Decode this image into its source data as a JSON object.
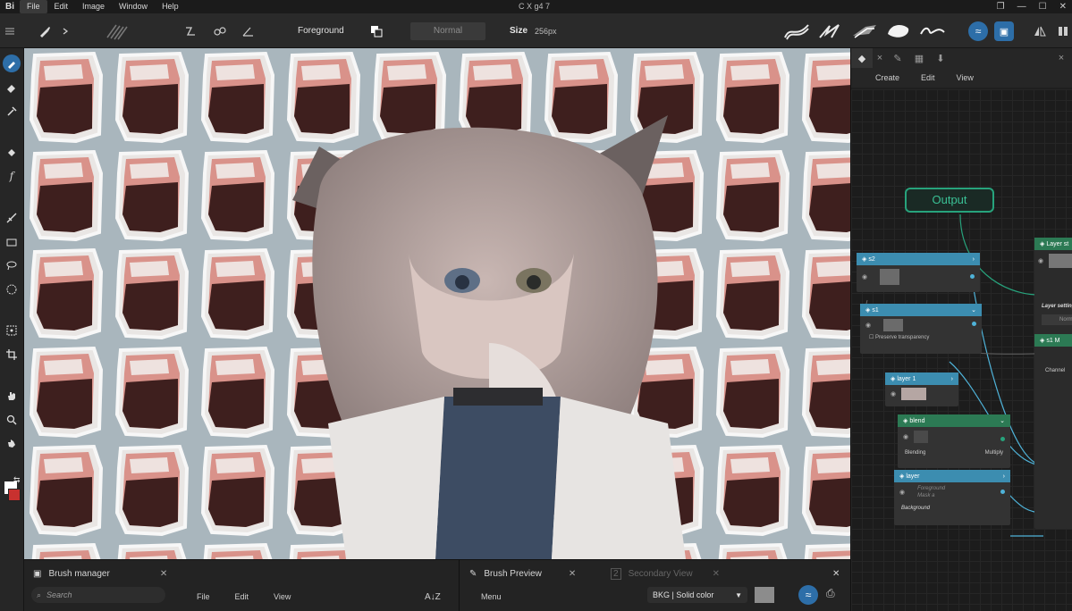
{
  "menubar": {
    "logo": "Bi",
    "items": [
      "File",
      "Edit",
      "Image",
      "Window",
      "Help"
    ],
    "title": "C X g4 7",
    "window_buttons": [
      "❐",
      "—",
      "☐",
      "✕"
    ]
  },
  "toolbar": {
    "color_source_label": "Foreground",
    "blend_mode": "Normal",
    "size_label": "Size",
    "size_value": "256px",
    "accent_color": "#2d6ea8"
  },
  "layer_panel": {
    "tabs": [
      "layers",
      "brush",
      "grid",
      "filter"
    ],
    "sub_menu": [
      "Create",
      "Edit",
      "View"
    ],
    "output_label": "Output",
    "nodes": {
      "s2": "s2",
      "s1": "s1",
      "s1_option": "Preserve transparency",
      "layer1": "layer 1",
      "blend": "blend",
      "blend_label": "Blending",
      "blend_value": "Multiply",
      "layer": "layer",
      "layer_fg": "Foreground",
      "layer_mask": "Mask a",
      "background": "Background",
      "layer_stack": "Layer st",
      "layer_settings": "Layer setting",
      "normal_short": "Norm",
      "s1m": "s1 M",
      "channel": "Channel"
    }
  },
  "brush_manager": {
    "title": "Brush manager",
    "search_placeholder": "Search",
    "menu": [
      "File",
      "Edit",
      "View"
    ],
    "sort_icon": "A↓Z"
  },
  "brush_preview": {
    "title": "Brush Preview",
    "secondary_number": "2",
    "secondary_title": "Secondary View",
    "menu_label": "Menu",
    "background_select": "BKG | Solid color",
    "swatch_color": "#8c8c8c"
  },
  "colors": {
    "foreground": "#c8312f",
    "background": "#ffffff",
    "node_blue": "#3c8db0",
    "node_green": "#2c7a54",
    "output_green": "#27a37c"
  }
}
